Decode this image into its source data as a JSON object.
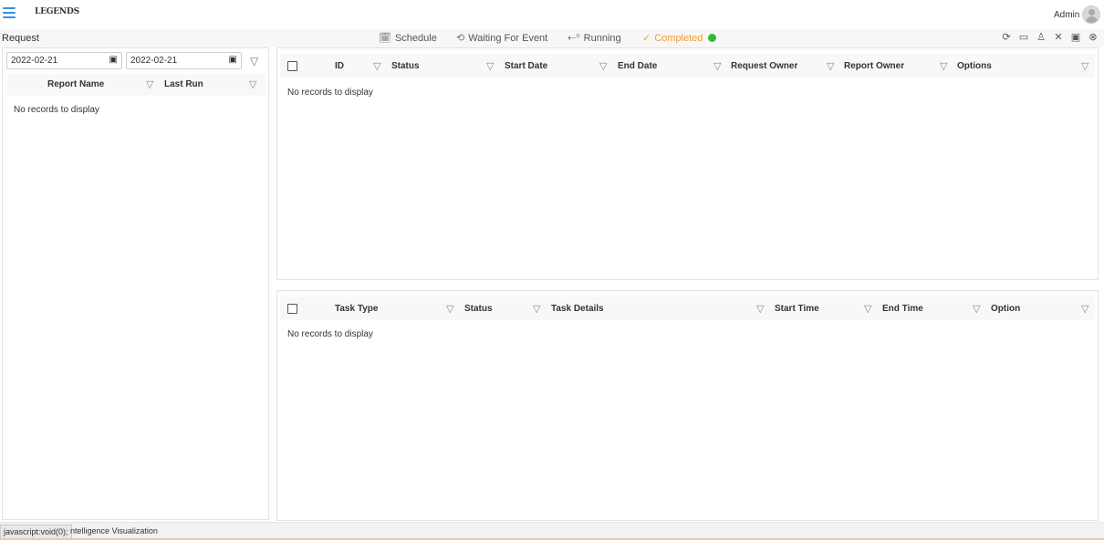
{
  "header": {
    "logo_text": "LEGENDS",
    "user_label": "Admin"
  },
  "toolbar": {
    "page_title": "Request",
    "tabs": [
      {
        "label": "Schedule",
        "icon": "calendar-clock-icon",
        "glyph": "📅"
      },
      {
        "label": "Waiting For Event",
        "icon": "clock-icon",
        "glyph": "⏲"
      },
      {
        "label": "Running",
        "icon": "run-arrow-icon",
        "glyph": "⇠"
      },
      {
        "label": "Completed",
        "icon": "check-icon",
        "glyph": "✓",
        "active": true
      }
    ],
    "completed_dot_color": "#2ebd3a",
    "active_tab_color": "#f0a030",
    "tool_icons": [
      "refresh-icon",
      "comment-icon",
      "user-icon",
      "close-icon",
      "window-icon",
      "circle-close-icon"
    ],
    "tool_glyphs": [
      "⟳",
      "▭",
      "♙",
      "✕",
      "▣",
      "⊗"
    ]
  },
  "left_panel": {
    "date_from": "2022-02-21",
    "date_to": "2022-02-21",
    "columns": [
      "Report Name",
      "Last Run"
    ],
    "empty_text": "No records to display"
  },
  "requests_grid": {
    "columns": [
      "ID",
      "Status",
      "Start Date",
      "End Date",
      "Request Owner",
      "Report Owner",
      "Options"
    ],
    "empty_text": "No records to display"
  },
  "tasks_grid": {
    "columns": [
      "Task Type",
      "Status",
      "Task Details",
      "Start Time",
      "End Time",
      "Option"
    ],
    "empty_text": "No records to display"
  },
  "statusbar": {
    "url": "javascript:void(0);",
    "text": "ntelligence Visualization"
  }
}
